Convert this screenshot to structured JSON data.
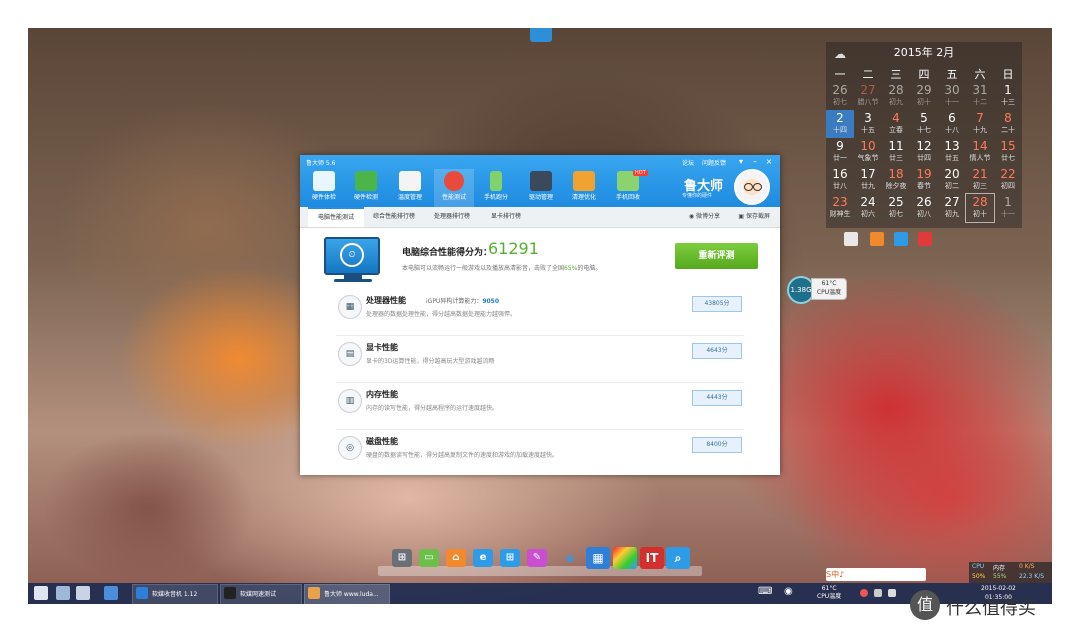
{
  "calendar": {
    "header": "2015年 2月",
    "weekdays": [
      "一",
      "二",
      "三",
      "四",
      "五",
      "六",
      "日"
    ],
    "days": [
      {
        "d": "26",
        "l": "初七",
        "dim": true
      },
      {
        "d": "27",
        "l": "腊八节",
        "dim": true,
        "red": true
      },
      {
        "d": "28",
        "l": "初九",
        "dim": true
      },
      {
        "d": "29",
        "l": "初十",
        "dim": true
      },
      {
        "d": "30",
        "l": "十一",
        "dim": true
      },
      {
        "d": "31",
        "l": "十二",
        "dim": true
      },
      {
        "d": "1",
        "l": "十三"
      },
      {
        "d": "2",
        "l": "十四",
        "today": true
      },
      {
        "d": "3",
        "l": "十五"
      },
      {
        "d": "4",
        "l": "立春",
        "red": true
      },
      {
        "d": "5",
        "l": "十七"
      },
      {
        "d": "6",
        "l": "十八"
      },
      {
        "d": "7",
        "l": "十九",
        "red": true
      },
      {
        "d": "8",
        "l": "二十",
        "red": true
      },
      {
        "d": "9",
        "l": "廿一"
      },
      {
        "d": "10",
        "l": "气象节",
        "red": true
      },
      {
        "d": "11",
        "l": "廿三"
      },
      {
        "d": "12",
        "l": "廿四"
      },
      {
        "d": "13",
        "l": "廿五"
      },
      {
        "d": "14",
        "l": "情人节",
        "red": true
      },
      {
        "d": "15",
        "l": "廿七",
        "red": true
      },
      {
        "d": "16",
        "l": "廿八"
      },
      {
        "d": "17",
        "l": "廿九"
      },
      {
        "d": "18",
        "l": "除夕夜",
        "red": true
      },
      {
        "d": "19",
        "l": "春节",
        "red": true
      },
      {
        "d": "20",
        "l": "初二"
      },
      {
        "d": "21",
        "l": "初三",
        "red": true
      },
      {
        "d": "22",
        "l": "初四",
        "red": true
      },
      {
        "d": "23",
        "l": "财神生",
        "red": true
      },
      {
        "d": "24",
        "l": "初六"
      },
      {
        "d": "25",
        "l": "初七"
      },
      {
        "d": "26",
        "l": "初八"
      },
      {
        "d": "27",
        "l": "初九"
      },
      {
        "d": "28",
        "l": "初十",
        "red": true,
        "sel": true
      },
      {
        "d": "1",
        "l": "十一",
        "dim": true
      }
    ]
  },
  "cpu_bubble": {
    "value": "1.38G",
    "temp": "61°C",
    "label": "CPU温度"
  },
  "app": {
    "title": "鲁大师 5.6",
    "links": [
      "论坛",
      "问题反馈"
    ],
    "min_glyph": "–",
    "close_glyph": "×",
    "tools": [
      "硬件体检",
      "硬件检测",
      "温度管理",
      "性能测试",
      "手机跑分",
      "驱动管理",
      "清理优化",
      "手机回收"
    ],
    "hot": "HOT",
    "brand": "鲁大师",
    "brand_sub": "专懂你的硬件",
    "tabs": [
      "电脑性能测试",
      "综合性能排行榜",
      "处理器排行榜",
      "显卡排行榜"
    ],
    "share": "微博分享",
    "save": "保存截屏",
    "score_label": "电脑综合性能得分为：",
    "score": "61291",
    "score_desc_pre": "本电脑可以流畅运行一般游戏以及播放高清影音，击败了全国",
    "score_pct": "65%",
    "score_desc_post": "的电脑。",
    "retest": "重新评测",
    "rows": [
      {
        "title": "处理器性能",
        "extra_label": "iGPU异构计算能力：",
        "extra_value": "9050",
        "desc": "处理器的数据处理性能，得分越高数据处理能力越强悍。",
        "score": "43805分"
      },
      {
        "title": "显卡性能",
        "extra_label": "",
        "extra_value": "",
        "desc": "显卡的3D运算性能，得分越高玩大型游戏越流畅",
        "score": "4643分"
      },
      {
        "title": "内存性能",
        "extra_label": "",
        "extra_value": "",
        "desc": "内存的读写性能，得分越高程序的运行速度越快。",
        "score": "4443分"
      },
      {
        "title": "磁盘性能",
        "extra_label": "",
        "extra_value": "",
        "desc": "硬盘的数据读写性能，得分越高复制文件的速度和游戏的加载速度越快。",
        "score": "8400分"
      }
    ]
  },
  "taskbar": {
    "tasks": [
      "软媒收音机 1.12",
      "软媒网速测试",
      "鲁大师 www.luda..."
    ],
    "tray_temp": "61°C",
    "tray_temp_label": "CPU温度",
    "date": "2015-02-02",
    "time": "01:35:00"
  },
  "netmon": {
    "cpu_label": "CPU",
    "cpu_val": "50%",
    "mem_label": "内存",
    "mem_val": "55%",
    "up": "0 K/S",
    "down": "22.3 K/S"
  },
  "sogou": "S中♪",
  "watermark": "什么值得买",
  "watermark_logo": "值"
}
